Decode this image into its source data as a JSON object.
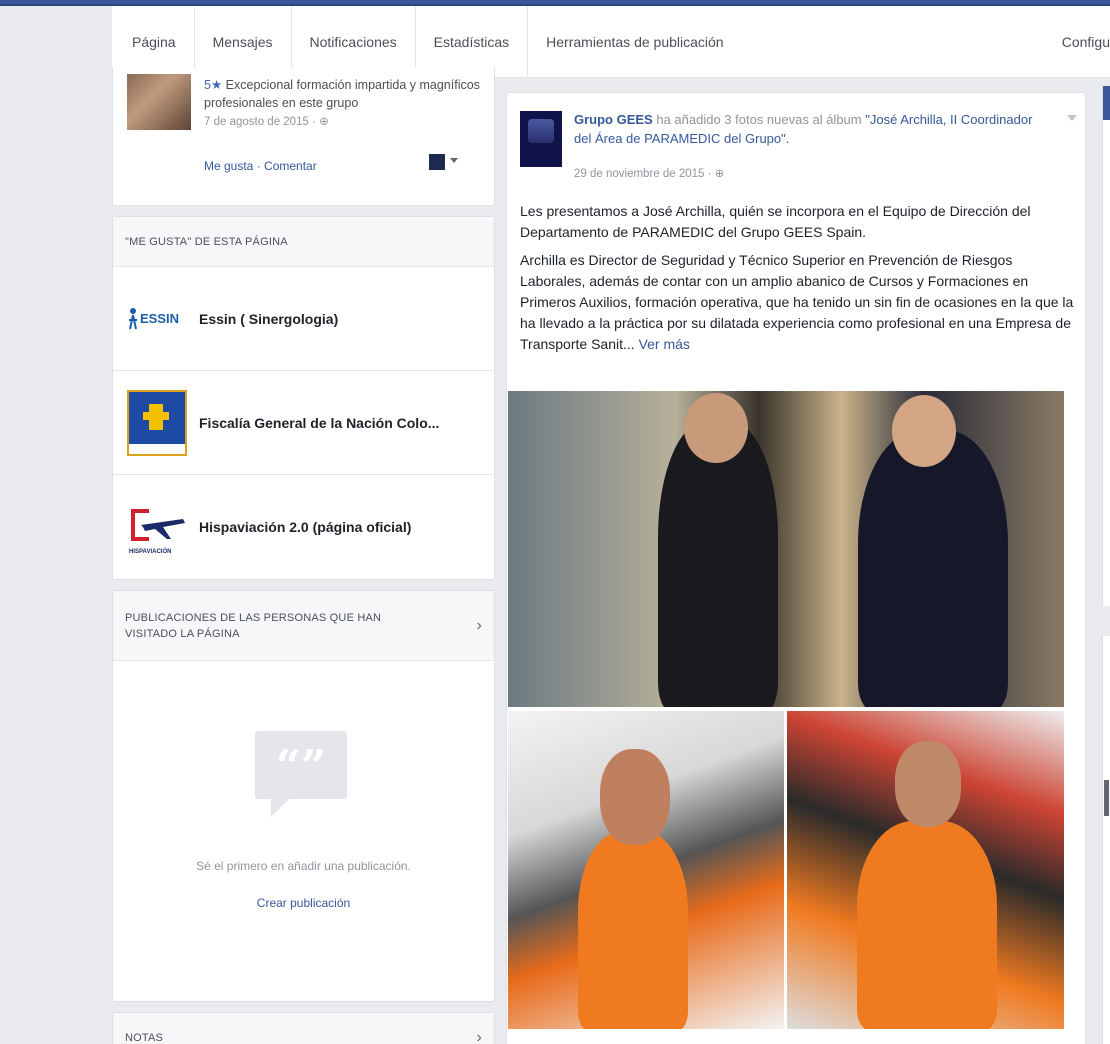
{
  "nav": {
    "items": [
      "Página",
      "Mensajes",
      "Notificaciones",
      "Estadísticas",
      "Herramientas de publicación"
    ],
    "config_label": "Configu"
  },
  "review": {
    "stars_label": "5★",
    "text": "Excepcional formación impartida y magníficos profesionales en este grupo",
    "date": "7 de agosto de 2015 · ⊕",
    "like_label": "Me gusta",
    "separator": " · ",
    "comment_label": "Comentar"
  },
  "likes": {
    "header": "\"ME GUSTA\" DE ESTA PÁGINA",
    "items": [
      {
        "name": "Essin ( Sinergologia)",
        "logo_text": "ESSIN"
      },
      {
        "name": "Fiscalía General de la Nación Colo..."
      },
      {
        "name": "Hispaviación 2.0 (página oficial)",
        "logo_text": "HISPAVIACIÓN"
      }
    ]
  },
  "visited": {
    "header": "PUBLICACIONES DE LAS PERSONAS QUE HAN VISITADO LA PÁGINA",
    "empty_text": "Sé el primero en añadir una publicación.",
    "create_link": "Crear publicación"
  },
  "notes": {
    "header": "NOTAS"
  },
  "post": {
    "author": "Grupo GEES",
    "action_text": " ha añadido 3 fotos nuevas al álbum ",
    "album": "\"José Archilla, II Coordinador del Área de PARAMEDIC del Grupo\".",
    "date": "29 de noviembre de 2015 · ⊕",
    "paragraph1": "Les presentamos a José Archilla, quién se incorpora en el Equipo de Dirección del Departamento de PARAMEDIC del Grupo GEES Spain.",
    "paragraph2": "Archilla es Director de Seguridad y Técnico Superior en Prevención de Riesgos Laborales, además de contar con un amplio abanico de Cursos y Formaciones en Primeros Auxilios, formación operativa, que ha tenido un sin fin de ocasiones en la que la ha llevado a la práctica por su dilatada experiencia como profesional en una Empresa de Transporte Sanit...",
    "see_more": "Ver más"
  },
  "colors": {
    "brand": "#3b5998",
    "link": "#365899",
    "background": "#e9ebee"
  }
}
